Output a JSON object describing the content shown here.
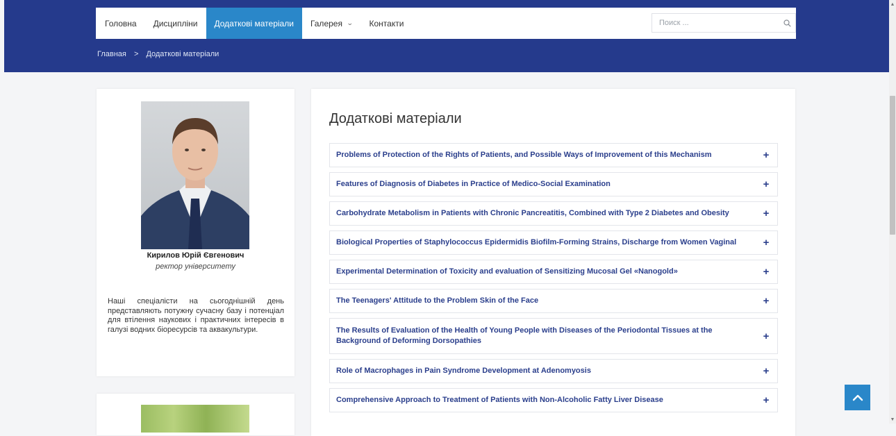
{
  "nav": {
    "items": [
      {
        "label": "Головна",
        "active": false,
        "dropdown": false
      },
      {
        "label": "Дисципліни",
        "active": false,
        "dropdown": false
      },
      {
        "label": "Додаткові матеріали",
        "active": true,
        "dropdown": false
      },
      {
        "label": "Галерея",
        "active": false,
        "dropdown": true
      },
      {
        "label": "Контакти",
        "active": false,
        "dropdown": false
      }
    ],
    "search_placeholder": "Поиск ...",
    "search_icon": "search-icon"
  },
  "breadcrumb": {
    "home": "Главная",
    "separator": ">",
    "current": "Додаткові матеріали"
  },
  "profile": {
    "name": "Кирилов Юрій Євгенович",
    "role": "ректор університету",
    "bio": "Наші спеціалісти на сьогоднішній день представляють потужну сучасну базу і потенціал для втілення наукових і практичних інтересів в галузі водних біоресурсів та аквакультури."
  },
  "main": {
    "title": "Додаткові матеріали",
    "items": [
      "Problems of Protection of the Rights of Patients, and Possible Ways of Improvement of this Mechanism",
      "Features of Diagnosis of Diabetes in Practice of Medico-Social Examination",
      "Carbohydrate Metabolism in Patients with Chronic Pancreatitis, Combined with Type 2 Diabetes and Obesity",
      "Biological Properties of Staphylococcus Epidermidis Biofilm-Forming Strains, Discharge from Women Vaginal",
      "Experimental Determination of Toxicity and evaluation of Sensitizing Mucosal Gel «Nanogold»",
      "The Teenagers' Attitude to the Problem Skin of the Face",
      "The Results of Evaluation of the Health of Young People with Diseases of the Periodontal Tissues at the Background of Deforming Dorsopathies",
      "Role of Macrophages in Pain Syndrome Development at Adenomyosis",
      "Comprehensive Approach to Treatment of Patients with Non-Alcoholic Fatty Liver Disease"
    ],
    "expand_symbol": "+"
  },
  "colors": {
    "header_bg": "#253a8c",
    "accent": "#2a87c9",
    "link": "#2b3f8c"
  }
}
